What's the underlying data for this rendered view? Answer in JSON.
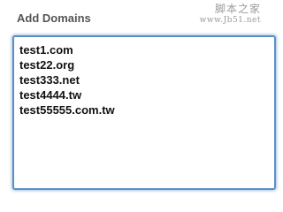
{
  "form": {
    "label": "Add Domains",
    "domains": [
      "test1.com",
      "test22.org",
      "test333.net",
      "test4444.tw",
      "test55555.com.tw"
    ]
  },
  "watermark": {
    "line1": "脚本之家",
    "line2": "www.Jb51.net"
  }
}
